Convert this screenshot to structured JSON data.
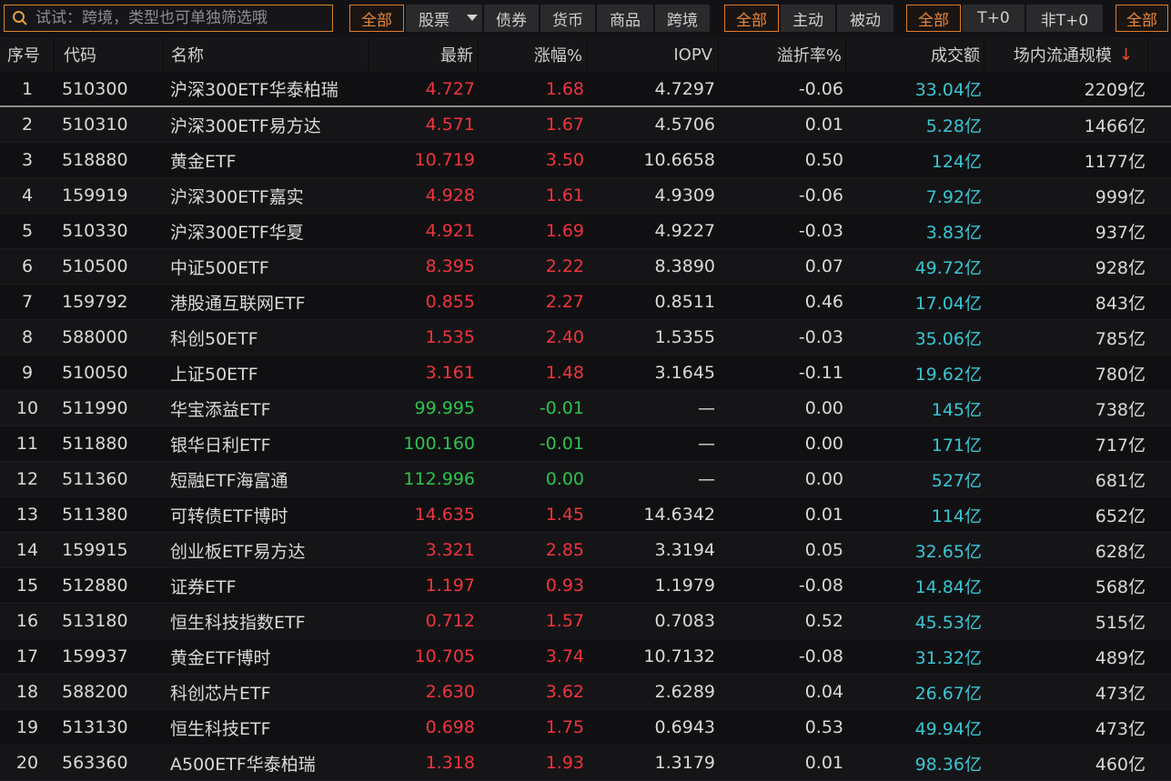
{
  "search": {
    "placeholder": "试试：跨境，类型也可单独筛选哦"
  },
  "filters": {
    "group1": [
      "全部",
      "股票",
      "债券",
      "货币",
      "商品",
      "跨境"
    ],
    "group2": [
      "全部",
      "主动",
      "被动"
    ],
    "group3": [
      "全部",
      "T+0",
      "非T+0"
    ],
    "group4": [
      "全部"
    ]
  },
  "columns": [
    "序号",
    "代码",
    "名称",
    "最新",
    "涨幅%",
    "IOPV",
    "溢折率%",
    "成交额",
    "场内流通规模"
  ],
  "sort_indicator": "↓",
  "colors": {
    "up": "#f0343c",
    "down": "#2ec24e",
    "volume": "#38c6d3",
    "accent": "#e07a2a"
  },
  "rows": [
    {
      "idx": "1",
      "code": "510300",
      "name": "沪深300ETF华泰柏瑞",
      "price": "4.727",
      "chg": "1.68",
      "iopv": "4.7297",
      "prem": "-0.06",
      "turnover": "33.04亿",
      "scale": "2209亿",
      "dir": "up"
    },
    {
      "idx": "2",
      "code": "510310",
      "name": "沪深300ETF易方达",
      "price": "4.571",
      "chg": "1.67",
      "iopv": "4.5706",
      "prem": "0.01",
      "turnover": "5.28亿",
      "scale": "1466亿",
      "dir": "up"
    },
    {
      "idx": "3",
      "code": "518880",
      "name": "黄金ETF",
      "price": "10.719",
      "chg": "3.50",
      "iopv": "10.6658",
      "prem": "0.50",
      "turnover": "124亿",
      "scale": "1177亿",
      "dir": "up"
    },
    {
      "idx": "4",
      "code": "159919",
      "name": "沪深300ETF嘉实",
      "price": "4.928",
      "chg": "1.61",
      "iopv": "4.9309",
      "prem": "-0.06",
      "turnover": "7.92亿",
      "scale": "999亿",
      "dir": "up"
    },
    {
      "idx": "5",
      "code": "510330",
      "name": "沪深300ETF华夏",
      "price": "4.921",
      "chg": "1.69",
      "iopv": "4.9227",
      "prem": "-0.03",
      "turnover": "3.83亿",
      "scale": "937亿",
      "dir": "up"
    },
    {
      "idx": "6",
      "code": "510500",
      "name": "中证500ETF",
      "price": "8.395",
      "chg": "2.22",
      "iopv": "8.3890",
      "prem": "0.07",
      "turnover": "49.72亿",
      "scale": "928亿",
      "dir": "up"
    },
    {
      "idx": "7",
      "code": "159792",
      "name": "港股通互联网ETF",
      "price": "0.855",
      "chg": "2.27",
      "iopv": "0.8511",
      "prem": "0.46",
      "turnover": "17.04亿",
      "scale": "843亿",
      "dir": "up"
    },
    {
      "idx": "8",
      "code": "588000",
      "name": "科创50ETF",
      "price": "1.535",
      "chg": "2.40",
      "iopv": "1.5355",
      "prem": "-0.03",
      "turnover": "35.06亿",
      "scale": "785亿",
      "dir": "up"
    },
    {
      "idx": "9",
      "code": "510050",
      "name": "上证50ETF",
      "price": "3.161",
      "chg": "1.48",
      "iopv": "3.1645",
      "prem": "-0.11",
      "turnover": "19.62亿",
      "scale": "780亿",
      "dir": "up"
    },
    {
      "idx": "10",
      "code": "511990",
      "name": "华宝添益ETF",
      "price": "99.995",
      "chg": "-0.01",
      "iopv": "—",
      "prem": "0.00",
      "turnover": "145亿",
      "scale": "738亿",
      "dir": "down"
    },
    {
      "idx": "11",
      "code": "511880",
      "name": "银华日利ETF",
      "price": "100.160",
      "chg": "-0.01",
      "iopv": "—",
      "prem": "0.00",
      "turnover": "171亿",
      "scale": "717亿",
      "dir": "down"
    },
    {
      "idx": "12",
      "code": "511360",
      "name": "短融ETF海富通",
      "price": "112.996",
      "chg": "0.00",
      "iopv": "—",
      "prem": "0.00",
      "turnover": "527亿",
      "scale": "681亿",
      "dir": "down"
    },
    {
      "idx": "13",
      "code": "511380",
      "name": "可转债ETF博时",
      "price": "14.635",
      "chg": "1.45",
      "iopv": "14.6342",
      "prem": "0.01",
      "turnover": "114亿",
      "scale": "652亿",
      "dir": "up"
    },
    {
      "idx": "14",
      "code": "159915",
      "name": "创业板ETF易方达",
      "price": "3.321",
      "chg": "2.85",
      "iopv": "3.3194",
      "prem": "0.05",
      "turnover": "32.65亿",
      "scale": "628亿",
      "dir": "up"
    },
    {
      "idx": "15",
      "code": "512880",
      "name": "证券ETF",
      "price": "1.197",
      "chg": "0.93",
      "iopv": "1.1979",
      "prem": "-0.08",
      "turnover": "14.84亿",
      "scale": "568亿",
      "dir": "up"
    },
    {
      "idx": "16",
      "code": "513180",
      "name": "恒生科技指数ETF",
      "price": "0.712",
      "chg": "1.57",
      "iopv": "0.7083",
      "prem": "0.52",
      "turnover": "45.53亿",
      "scale": "515亿",
      "dir": "up"
    },
    {
      "idx": "17",
      "code": "159937",
      "name": "黄金ETF博时",
      "price": "10.705",
      "chg": "3.74",
      "iopv": "10.7132",
      "prem": "-0.08",
      "turnover": "31.32亿",
      "scale": "489亿",
      "dir": "up"
    },
    {
      "idx": "18",
      "code": "588200",
      "name": "科创芯片ETF",
      "price": "2.630",
      "chg": "3.62",
      "iopv": "2.6289",
      "prem": "0.04",
      "turnover": "26.67亿",
      "scale": "473亿",
      "dir": "up"
    },
    {
      "idx": "19",
      "code": "513130",
      "name": "恒生科技ETF",
      "price": "0.698",
      "chg": "1.75",
      "iopv": "0.6943",
      "prem": "0.53",
      "turnover": "49.94亿",
      "scale": "473亿",
      "dir": "up"
    },
    {
      "idx": "20",
      "code": "563360",
      "name": "A500ETF华泰柏瑞",
      "price": "1.318",
      "chg": "1.93",
      "iopv": "1.3179",
      "prem": "0.01",
      "turnover": "98.36亿",
      "scale": "460亿",
      "dir": "up"
    }
  ]
}
